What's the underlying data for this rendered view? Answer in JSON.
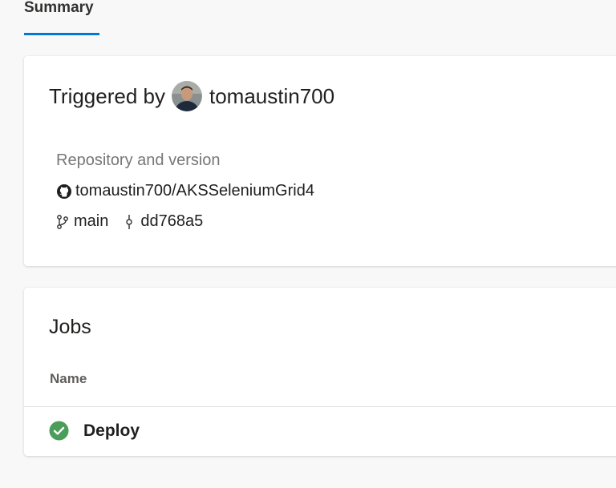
{
  "tabs": {
    "summary_label": "Summary"
  },
  "summary": {
    "triggered_by_label": "Triggered by",
    "username": "tomaustin700",
    "repository_label": "Repository and version",
    "repository_name": "tomaustin700/AKSSeleniumGrid4",
    "branch": "main",
    "commit": "dd768a5"
  },
  "jobs": {
    "title": "Jobs",
    "column_name": "Name",
    "items": [
      {
        "name": "Deploy",
        "status": "succeeded",
        "status_icon": "success-check-icon",
        "status_color": "#4a9d5a"
      }
    ]
  },
  "colors": {
    "accent": "#0078d4",
    "success": "#4a9d5a"
  }
}
